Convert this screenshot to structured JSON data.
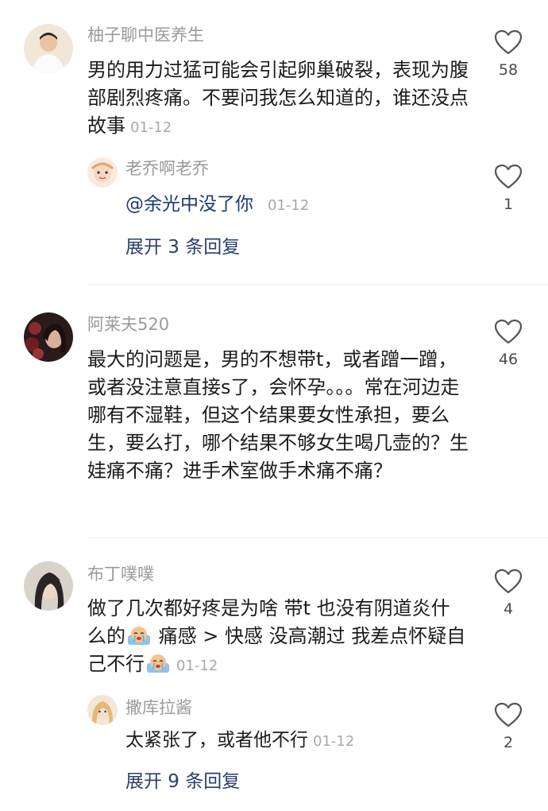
{
  "comments": [
    {
      "username": "柚子聊中医养生",
      "text": "男的用力过猛可能会引起卵巢破裂，表现为腹部剧烈疼痛。不要问我怎么知道的，谁还没点故事",
      "date": "01-12",
      "likes": "58",
      "reply": {
        "username": "老乔啊老乔",
        "text": "@余光中没了你",
        "date": "01-12",
        "likes": "1"
      },
      "expand_label": "展开 3 条回复"
    },
    {
      "username": "阿莱夫520",
      "text": "最大的问题是，男的不想带t，或者蹭一蹭，或者没注意直接s了，会怀孕。。。常在河边走哪有不湿鞋，但这个结果要女性承担，要么生，要么打，哪个结果不够女生喝几壶的？生娃痛不痛？进手术室做手术痛不痛？",
      "likes": "46"
    },
    {
      "username": "布丁噗噗",
      "text_part1": "做了几次都好疼是为啥 带t 也没有阴道炎什么的",
      "text_part2": " 痛感 > 快感 没高潮过 我差点怀疑自己不行",
      "date": "01-12",
      "likes": "4",
      "reply": {
        "username": "撒库拉酱",
        "text": "太紧张了，或者他不行",
        "date": "01-12",
        "likes": "2"
      },
      "expand_label": "展开 9 条回复"
    }
  ],
  "icons": {
    "like": "heart-outline-icon",
    "emoji": "crying-face-emoji"
  },
  "colors": {
    "username": "#9a9a9a",
    "expand_link": "#2b3f6b",
    "date": "#a8a8a8"
  }
}
